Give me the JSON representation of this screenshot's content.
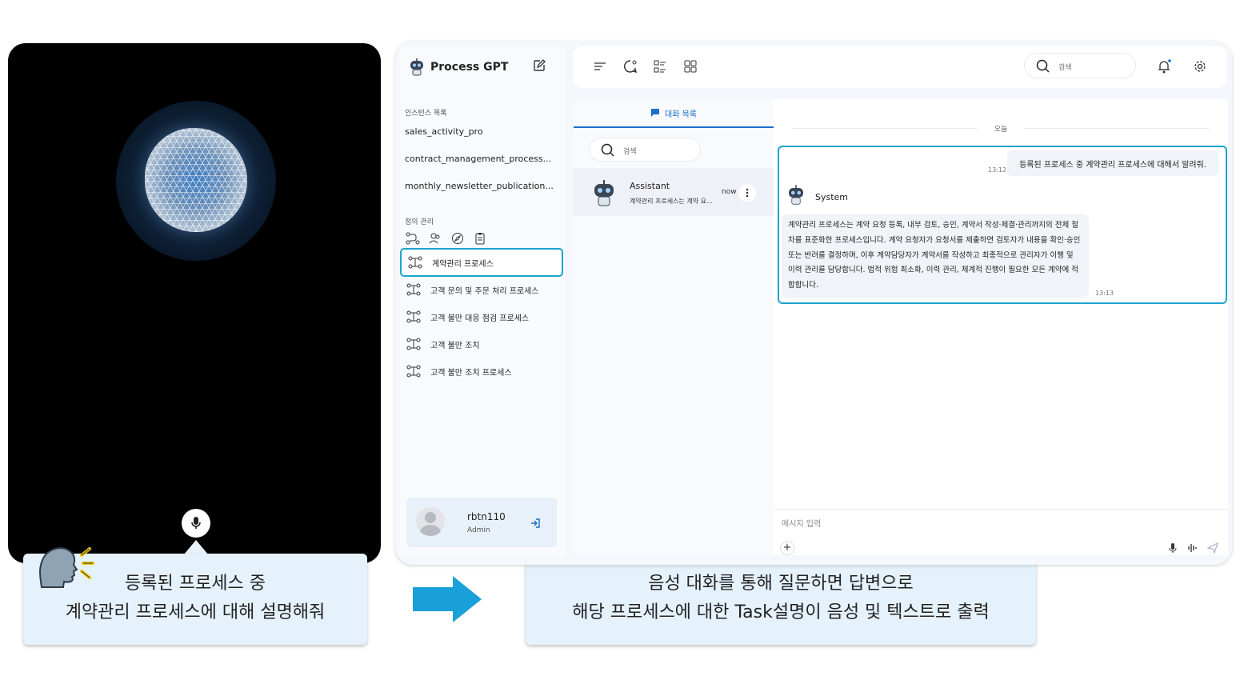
{
  "voice": {
    "bubble_line1": "등록된 프로세스 중",
    "bubble_line2": "계약관리 프로세스에 대해 설명해줘"
  },
  "caption": {
    "line1": "음성 대화를 통해 질문하면 답변으로",
    "line2": "해당 프로세스에 대한 Task설명이 음성 및 텍스트로 출력"
  },
  "app": {
    "title": "Process GPT",
    "instances_label": "인스턴스 목록",
    "instances": [
      "sales_activity_pro",
      "contract_management_process...",
      "monthly_newsletter_publication..."
    ],
    "definitions_label": "정의 관리",
    "definitions": [
      "계약관리 프로세스",
      "고객 문의 및 주문 처리 프로세스",
      "고객 불만 대응 점검 프로세스",
      "고객 불만 조치",
      "고객 불만 조치 프로세스"
    ],
    "user": {
      "name": "rbtn110",
      "role": "Admin"
    },
    "search_placeholder": "검색",
    "tab_label": "대화 목록",
    "convo_search_placeholder": "검색",
    "convo": {
      "name": "Assistant",
      "time": "now",
      "preview": "계약관리 프로세스는 계약 요..."
    },
    "chat": {
      "today": "오늘",
      "user_message": "등록된 프로세스 중 계약관리 프로세스에 대해서 알려줘.",
      "user_time": "13:12",
      "system_name": "System",
      "system_message": "계약관리 프로세스는 계약 요청 등록, 내부 검토, 승인, 계약서 작성·체결·관리까지의 전체 절차를 표준화한 프로세스입니다. 계약 요청자가 요청서를 제출하면 검토자가 내용을 확인·승인 또는 반려를 결정하며, 이후 계약담당자가 계약서를 작성하고 최종적으로 관리자가 이행 및 이력 관리를 담당합니다. 법적 위험 최소화, 이력 관리, 체계적 진행이 필요한 모든 계약에 적합합니다.",
      "system_time": "13:13",
      "input_placeholder": "메시지 입력"
    }
  },
  "colors": {
    "accent": "#1ea3cf",
    "primary": "#1a6fc9",
    "bubble": "#e5f1fb"
  }
}
